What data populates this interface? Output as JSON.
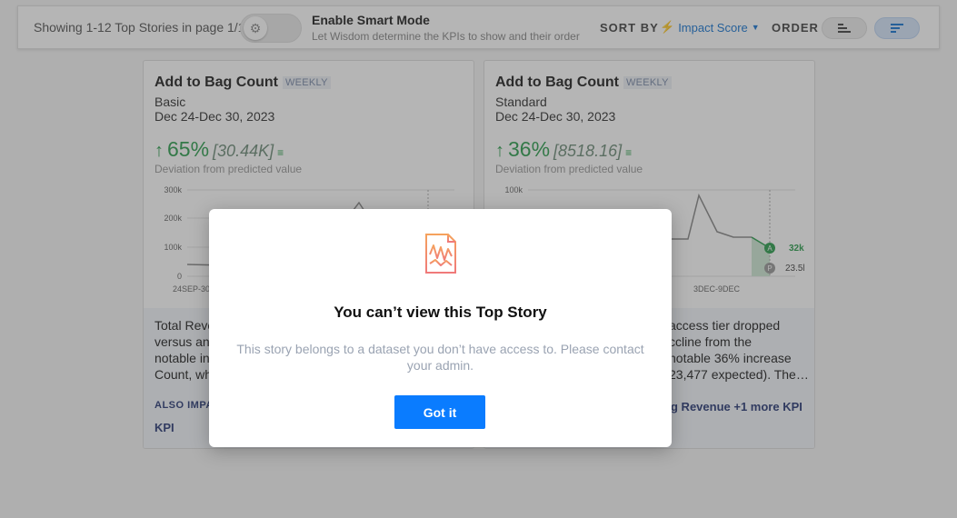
{
  "toolbar": {
    "showing_text": "Showing 1-12 Top Stories in page 1/1",
    "smart_mode_title": "Enable Smart Mode",
    "smart_mode_subtitle": "Let Wisdom determine the KPIs to show and their order",
    "sort_by_label": "SORT BY",
    "sort_value": "Impact Score",
    "order_label": "ORDER"
  },
  "cards": [
    {
      "title": "Add to Bag Count",
      "badge": "WEEKLY",
      "tier": "Basic",
      "date": "Dec 24-Dec 30, 2023",
      "metric_pct": "65%",
      "metric_value": "[30.44K]",
      "deviation_label": "Deviation from predicted value",
      "y_ticks": [
        "300k",
        "200k",
        "100k",
        "0"
      ],
      "x_tick": "24SEP-30",
      "story_text": "Total Reve... versus an... notable in... Count, wh...",
      "story_lines": [
        "Total Reve",
        "versus an",
        "notable in",
        "Count, wh"
      ],
      "also_label": "ALSO IMPAC",
      "also_kpi": "KPI"
    },
    {
      "title": "Add to Bag Count",
      "badge": "WEEKLY",
      "tier": "Standard",
      "date": "Dec 24-Dec 30, 2023",
      "metric_pct": "36%",
      "metric_value": "[8518.16]",
      "deviation_label": "Deviation from predicted value",
      "y_tick": "100k",
      "x_tick": "3DEC-9DEC",
      "actual_label": "32k",
      "predicted_label": "23.5k",
      "actual_marker": "A",
      "predicted_marker": "P",
      "story_lines": [
        "access tier dropped",
        "ccline from the",
        "notable 36% increase",
        "23,477 expected). The…"
      ],
      "also_more": "g Revenue +1 more KPI"
    }
  ],
  "modal": {
    "title": "You can’t view this Top Story",
    "body": "This story belongs to a dataset you don’t have access to. Please contact your admin.",
    "button_label": "Got it"
  },
  "colors": {
    "accent": "#0a7cff",
    "positive": "#2e9e4f",
    "link": "#1976d2"
  }
}
